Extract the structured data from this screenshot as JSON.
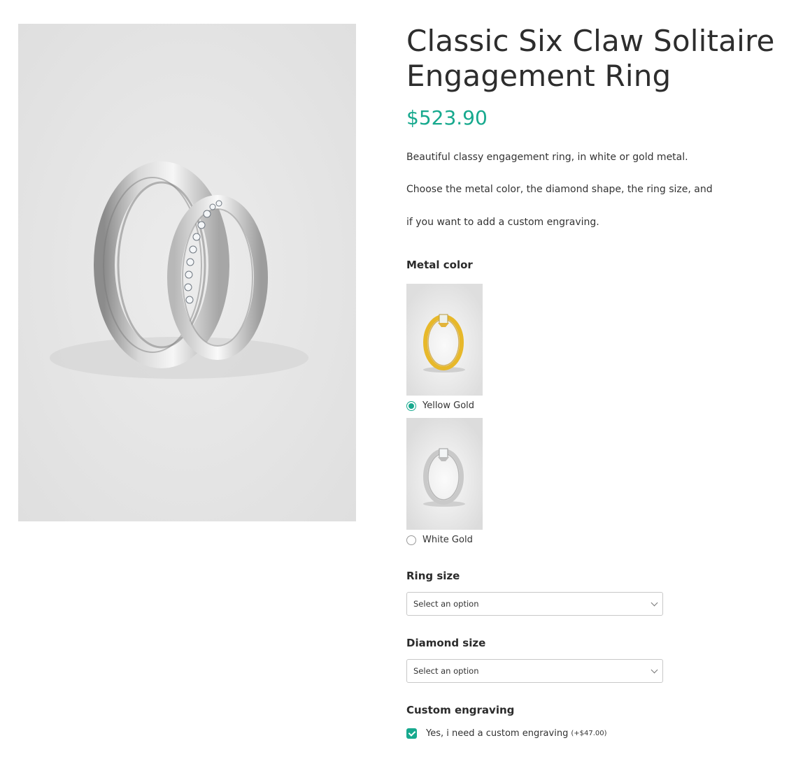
{
  "product": {
    "title_line1": "Classic Six Claw Solitaire",
    "title_line2": "Engagement Ring",
    "price": "$523.90",
    "description": [
      "Beautiful classy engagement ring, in white or gold metal.",
      "Choose the metal color, the diamond shape, the ring size, and",
      "if you want to add a custom engraving."
    ]
  },
  "metal_color": {
    "label": "Metal color",
    "options": [
      {
        "label": "Yellow Gold",
        "selected": true
      },
      {
        "label": "White Gold",
        "selected": false
      }
    ]
  },
  "ring_size": {
    "label": "Ring size",
    "value": "Select an option"
  },
  "diamond_size": {
    "label": "Diamond size",
    "value": "Select an option"
  },
  "custom_engraving": {
    "label": "Custom engraving",
    "option_label": "Yes, i need a custom engraving",
    "addon_price": "(+$47.00)",
    "checked": true
  },
  "colors": {
    "accent": "#17a98e",
    "image_bg": "#e2e2e2"
  }
}
